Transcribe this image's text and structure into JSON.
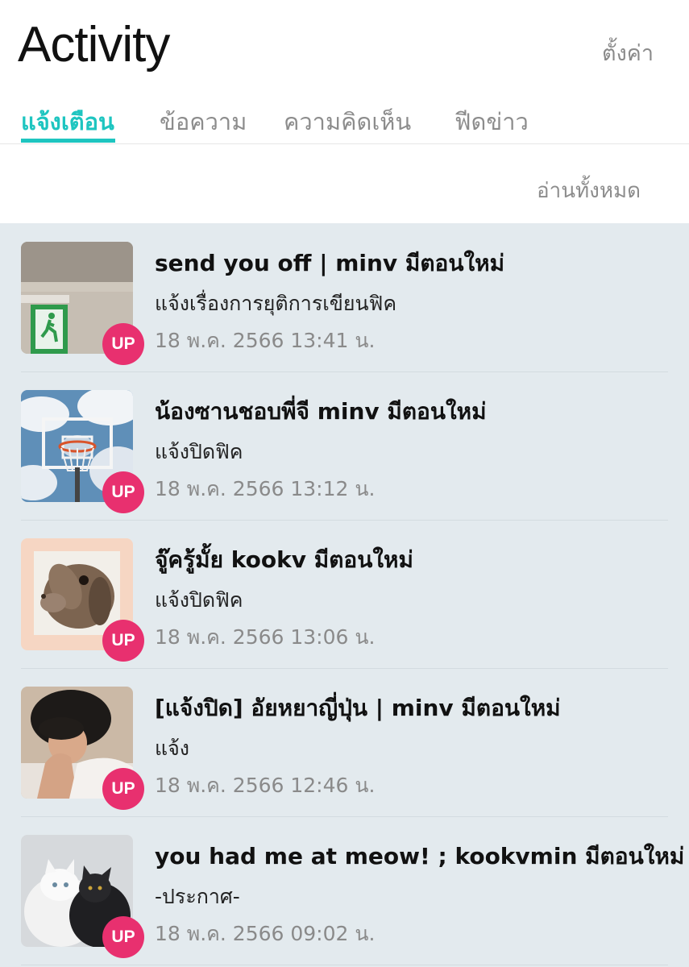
{
  "header": {
    "title": "Activity",
    "settings_label": "ตั้งค่า"
  },
  "tabs": [
    {
      "label": "แจ้งเตือน",
      "active": true
    },
    {
      "label": "ข้อความ",
      "active": false
    },
    {
      "label": "ความคิดเห็น",
      "active": false
    },
    {
      "label": "ฟีดข่าว",
      "active": false
    }
  ],
  "read_all_label": "อ่านทั้งหมด",
  "accent_color": "#1ec5c0",
  "badge_color": "#e8306f",
  "notifications": [
    {
      "title": "send you off | minv มีตอนใหม่",
      "subtitle": "แจ้งเรื่องการยุติการเขียนฟิค",
      "time": "18 พ.ค. 2566 13:41 น.",
      "badge": "UP",
      "thumb": "exit-sign-image"
    },
    {
      "title": "น้องซานชอบพี่จี minv มีตอนใหม่",
      "subtitle": "แจ้งปิดฟิค",
      "time": "18 พ.ค. 2566 13:12 น.",
      "badge": "UP",
      "thumb": "basketball-hoop-image"
    },
    {
      "title": "จู๊ครู้มั้ย kookv มีตอนใหม่",
      "subtitle": "แจ้งปิดฟิค",
      "time": "18 พ.ค. 2566 13:06 น.",
      "badge": "UP",
      "thumb": "bunny-image"
    },
    {
      "title": "[แจ้งปิด] อัยหยาญี่ปุ่น | minv  มีตอนใหม่",
      "subtitle": "แจ้ง",
      "time": "18 พ.ค. 2566 12:46 น.",
      "badge": "UP",
      "thumb": "person-portrait-image"
    },
    {
      "title": "you had me at meow! ; kookvmin มีตอนใหม่",
      "subtitle": "-ประกาศ-",
      "time": "18 พ.ค. 2566 09:02 น.",
      "badge": "UP",
      "thumb": "cats-image"
    }
  ]
}
